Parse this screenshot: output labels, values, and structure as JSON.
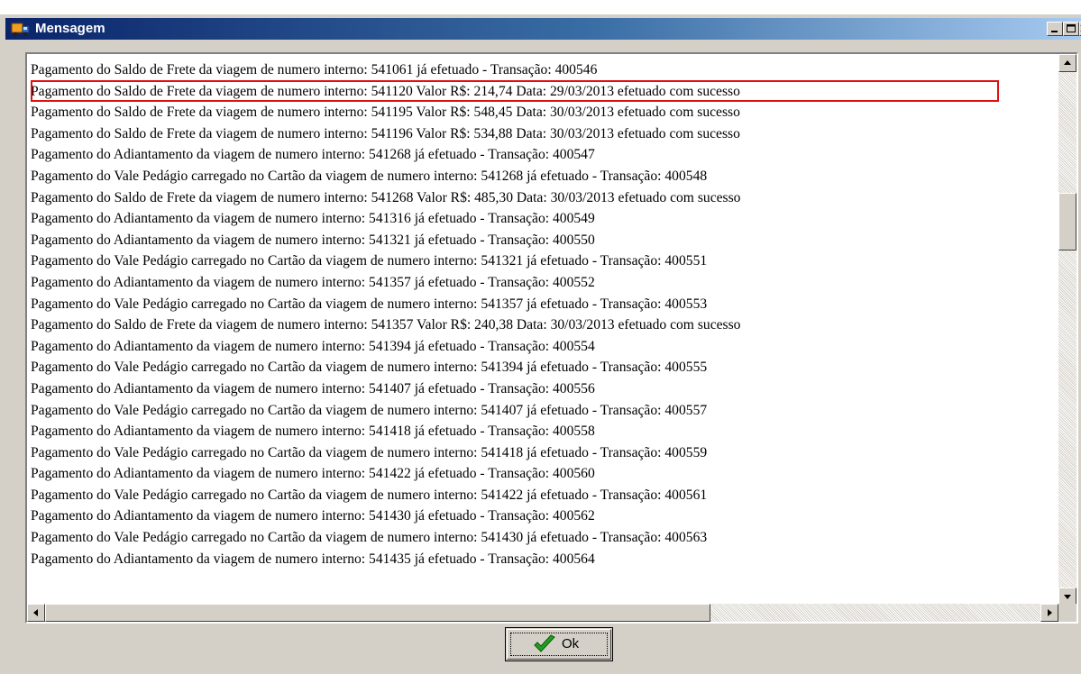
{
  "window": {
    "title": "Mensagem"
  },
  "messages": [
    "Pagamento do Saldo de Frete da viagem de numero interno: 541061 já efetuado - Transação: 400546",
    "Pagamento do Saldo de Frete da viagem de numero interno: 541120 Valor R$: 214,74 Data: 29/03/2013 efetuado com sucesso",
    "Pagamento do Saldo de Frete da viagem de numero interno: 541195 Valor R$: 548,45 Data: 30/03/2013 efetuado com sucesso",
    "Pagamento do Saldo de Frete da viagem de numero interno: 541196 Valor R$: 534,88 Data: 30/03/2013 efetuado com sucesso",
    "Pagamento do Adiantamento da viagem de numero interno: 541268 já efetuado - Transação: 400547",
    "Pagamento do Vale Pedágio carregado no Cartão da viagem de numero interno: 541268 já efetuado - Transação: 400548",
    "Pagamento do Saldo de Frete da viagem de numero interno: 541268 Valor R$: 485,30 Data: 30/03/2013 efetuado com sucesso",
    "Pagamento do Adiantamento da viagem de numero interno: 541316 já efetuado - Transação: 400549",
    "Pagamento do Adiantamento da viagem de numero interno: 541321 já efetuado - Transação: 400550",
    "Pagamento do Vale Pedágio carregado no Cartão da viagem de numero interno: 541321 já efetuado - Transação: 400551",
    "Pagamento do Adiantamento da viagem de numero interno: 541357 já efetuado - Transação: 400552",
    "Pagamento do Vale Pedágio carregado no Cartão da viagem de numero interno: 541357 já efetuado - Transação: 400553",
    "Pagamento do Saldo de Frete da viagem de numero interno: 541357 Valor R$: 240,38 Data: 30/03/2013 efetuado com sucesso",
    "Pagamento do Adiantamento da viagem de numero interno: 541394 já efetuado - Transação: 400554",
    "Pagamento do Vale Pedágio carregado no Cartão da viagem de numero interno: 541394 já efetuado - Transação: 400555",
    "Pagamento do Adiantamento da viagem de numero interno: 541407 já efetuado - Transação: 400556",
    "Pagamento do Vale Pedágio carregado no Cartão da viagem de numero interno: 541407 já efetuado - Transação: 400557",
    "Pagamento do Adiantamento da viagem de numero interno: 541418 já efetuado - Transação: 400558",
    "Pagamento do Vale Pedágio carregado no Cartão da viagem de numero interno: 541418 já efetuado - Transação: 400559",
    "Pagamento do Adiantamento da viagem de numero interno: 541422 já efetuado - Transação: 400560",
    "Pagamento do Vale Pedágio carregado no Cartão da viagem de numero interno: 541422 já efetuado - Transação: 400561",
    "Pagamento do Adiantamento da viagem de numero interno: 541430 já efetuado - Transação: 400562",
    "Pagamento do Vale Pedágio carregado no Cartão da viagem de numero interno: 541430 já efetuado - Transação: 400563",
    "Pagamento do Adiantamento da viagem de numero interno: 541435 já efetuado - Transação: 400564"
  ],
  "highlighted_message_index": 1,
  "highlight_color": "#e01010",
  "buttons": {
    "ok_label": "Ok"
  },
  "icons": {
    "app": "truck-app-icon",
    "ok": "green-checkmark-icon"
  }
}
